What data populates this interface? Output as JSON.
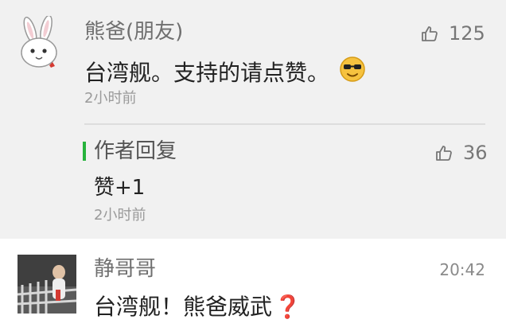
{
  "comments": [
    {
      "username": "熊爸(朋友)",
      "likes": "125",
      "text": "台湾舰。支持的请点赞。",
      "time": "2小时前",
      "avatar_icon": "rabbit-avatar-icon",
      "emoji_icon": "sunglasses-smiley-icon",
      "author_reply": {
        "label": "作者回复",
        "text": "赞+1",
        "likes": "36",
        "time": "2小时前",
        "accent_color": "#26b33c"
      }
    },
    {
      "username": "静哥哥",
      "time": "20:42",
      "text_main": "台湾舰！熊爸威武",
      "text_mark": "❓",
      "mark_color": "#d9302a",
      "avatar_icon": "photo-avatar"
    }
  ],
  "icons": {
    "like": "thumbs-up-icon"
  }
}
